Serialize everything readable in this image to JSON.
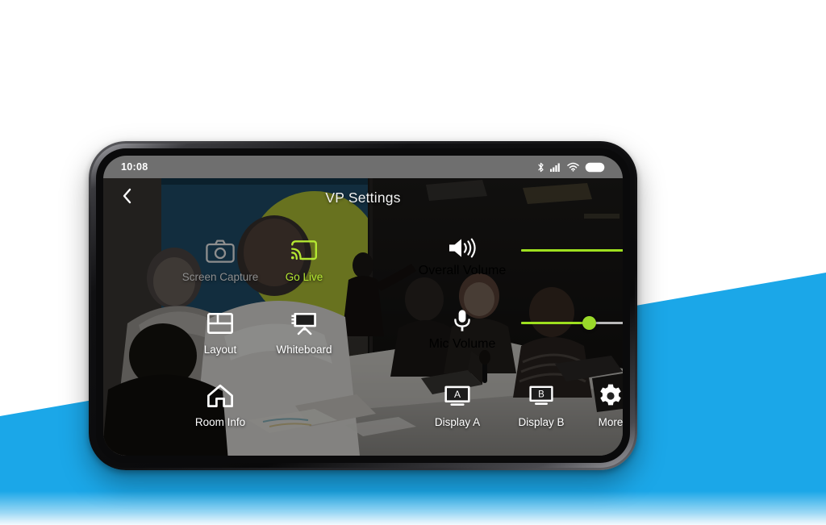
{
  "background": {
    "page_bg": "#ffffff",
    "accent_blue": "#1ba7e8"
  },
  "phone": {
    "status_bar": {
      "time": "10:08",
      "icons": [
        "bluetooth-icon",
        "cellular-signal-icon",
        "wifi-icon",
        "battery-icon"
      ],
      "bg_color": "#6f6f6f"
    }
  },
  "app": {
    "header": {
      "back_icon": "chevron-left-icon",
      "title": "VP Settings"
    },
    "colors": {
      "active_green": "#b4e832",
      "slider_green": "#9ee01f",
      "disabled_gray": "#8e8e8e",
      "track_gray": "#b9b9b9"
    },
    "tiles": [
      {
        "id": "screen-capture",
        "label": "Screen Capture",
        "icon": "camera-icon",
        "state": "disabled"
      },
      {
        "id": "go-live",
        "label": "Go Live",
        "icon": "cast-icon",
        "state": "active"
      },
      {
        "id": "layout",
        "label": "Layout",
        "icon": "layout-grid-icon",
        "state": "normal"
      },
      {
        "id": "whiteboard",
        "label": "Whiteboard",
        "icon": "whiteboard-icon",
        "state": "normal"
      },
      {
        "id": "room-info",
        "label": "Room Info",
        "icon": "home-icon",
        "state": "normal"
      },
      {
        "id": "display-a",
        "label": "Display A",
        "icon": "monitor-a-icon",
        "state": "normal"
      },
      {
        "id": "display-b",
        "label": "Display B",
        "icon": "monitor-b-icon",
        "state": "normal"
      },
      {
        "id": "more",
        "label": "More",
        "icon": "gear-icon",
        "state": "normal"
      }
    ],
    "sliders": [
      {
        "id": "overall-volume",
        "label": "Overall Volume",
        "icon": "speaker-icon",
        "value": 90
      },
      {
        "id": "mic-volume",
        "label": "Mic Volume",
        "icon": "microphone-icon",
        "value": 50
      }
    ]
  }
}
